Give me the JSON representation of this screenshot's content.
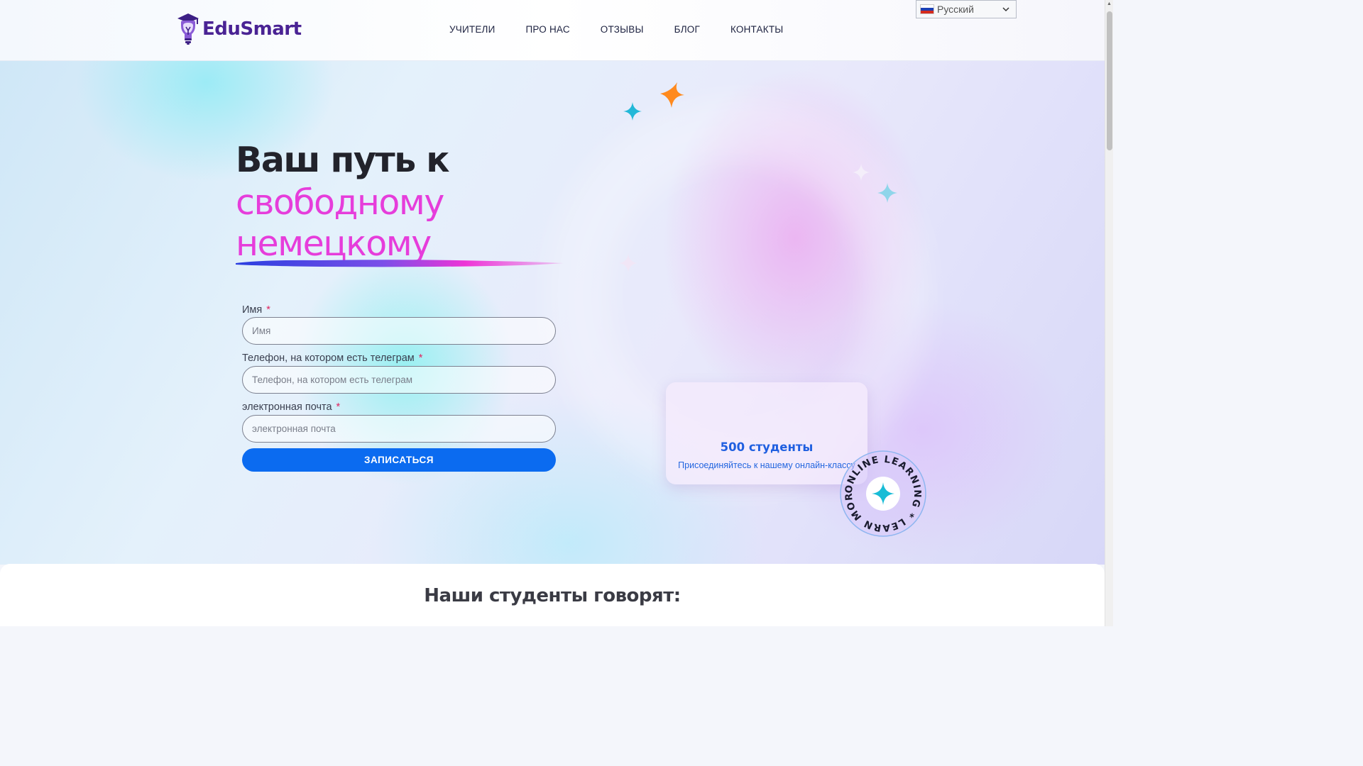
{
  "brand": {
    "name": "EduSmart",
    "color": "#4a2394"
  },
  "nav": {
    "items": [
      {
        "label": "УЧИТЕЛИ"
      },
      {
        "label": "ПРО НАС"
      },
      {
        "label": "ОТЗЫВЫ"
      },
      {
        "label": "БЛОГ"
      },
      {
        "label": "КОНТАКТЫ"
      }
    ]
  },
  "language": {
    "selected": "Русский",
    "icon": "russia-flag-icon"
  },
  "hero": {
    "title_line1": "Ваш путь к",
    "title_line2": "свободному",
    "title_line3": "немецкому",
    "accent_color": "#e63ddb"
  },
  "form": {
    "name": {
      "label": "Имя",
      "required_mark": "*",
      "placeholder": "Имя",
      "value": ""
    },
    "phone": {
      "label": "Телефон, на котором есть телеграм",
      "required_mark": "*",
      "placeholder": "Телефон, на котором есть телеграм",
      "value": ""
    },
    "email": {
      "label": "электронная почта",
      "required_mark": "*",
      "placeholder": "электронная почта",
      "value": ""
    },
    "submit_label": "ЗАПИСАТЬСЯ",
    "button_color": "#0b6bf0"
  },
  "stats_card": {
    "count": "500 студенты",
    "subtitle": "Присоединяйтесь к нашему онлайн-классу"
  },
  "badge": {
    "text": "ONLINE LEARNING * LEARN MORE *",
    "icon": "sparkle-icon"
  },
  "testimonials": {
    "title": "Наши студенты говорят:"
  }
}
